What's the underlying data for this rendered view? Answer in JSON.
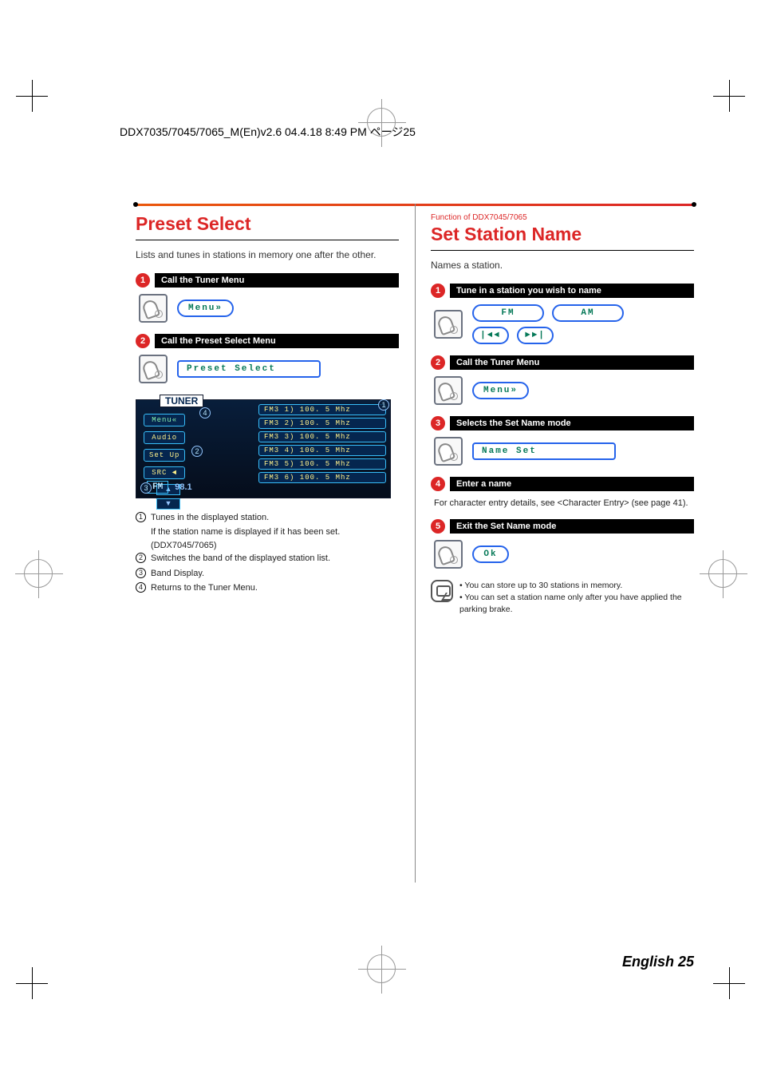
{
  "header_line": "DDX7035/7045/7065_M(En)v2.6  04.4.18  8:49 PM  ページ25",
  "footer": "English 25",
  "left": {
    "title": "Preset Select",
    "subtitle": "Lists and tunes in stations in memory one after the other.",
    "steps": [
      {
        "num": "1",
        "title": "Call the Tuner Menu",
        "button": "Menu»"
      },
      {
        "num": "2",
        "title": "Call the Preset Select Menu",
        "button": "Preset Select"
      }
    ],
    "shot": {
      "title": "TUNER",
      "menu": "Menu«",
      "audio": "Audio",
      "setup": "Set Up",
      "src": "SRC ◄",
      "arrow_up": "▲",
      "arrow_down": "▼",
      "band": "FM",
      "freq": "98.1",
      "presets": [
        "FM3 1) 100. 5 Mhz",
        "FM3 2) 100. 5 Mhz",
        "FM3 3) 100. 5 Mhz",
        "FM3 4) 100. 5 Mhz",
        "FM3 5) 100. 5 Mhz",
        "FM3 6) 100. 5 Mhz"
      ],
      "callouts": {
        "c1": "1",
        "c2": "2",
        "c3": "3",
        "c4": "4"
      }
    },
    "legend": [
      {
        "n": "1",
        "text": "Tunes in the displayed station.",
        "sub": "If the station name is displayed if it has been set. (DDX7045/7065)"
      },
      {
        "n": "2",
        "text": "Switches the band of the displayed station list."
      },
      {
        "n": "3",
        "text": "Band Display."
      },
      {
        "n": "4",
        "text": "Returns to the Tuner Menu."
      }
    ]
  },
  "right": {
    "fn_note": "Function of DDX7045/7065",
    "title": "Set Station Name",
    "subtitle": "Names a station.",
    "steps": {
      "s1": {
        "num": "1",
        "title": "Tune in a station you wish to name",
        "fm": "FM",
        "am": "AM",
        "prev": "|◄◄",
        "next": "►►|"
      },
      "s2": {
        "num": "2",
        "title": "Call the Tuner Menu",
        "button": "Menu»"
      },
      "s3": {
        "num": "3",
        "title": "Selects the Set Name mode",
        "button": "Name Set"
      },
      "s4": {
        "num": "4",
        "title": "Enter a name",
        "note": "For character entry details, see <Character Entry> (see page 41)."
      },
      "s5": {
        "num": "5",
        "title": "Exit the Set Name mode",
        "button": "Ok"
      }
    },
    "notes": [
      "You can store up to 30 stations in memory.",
      "You can set a station name only after you have applied the parking brake."
    ]
  }
}
